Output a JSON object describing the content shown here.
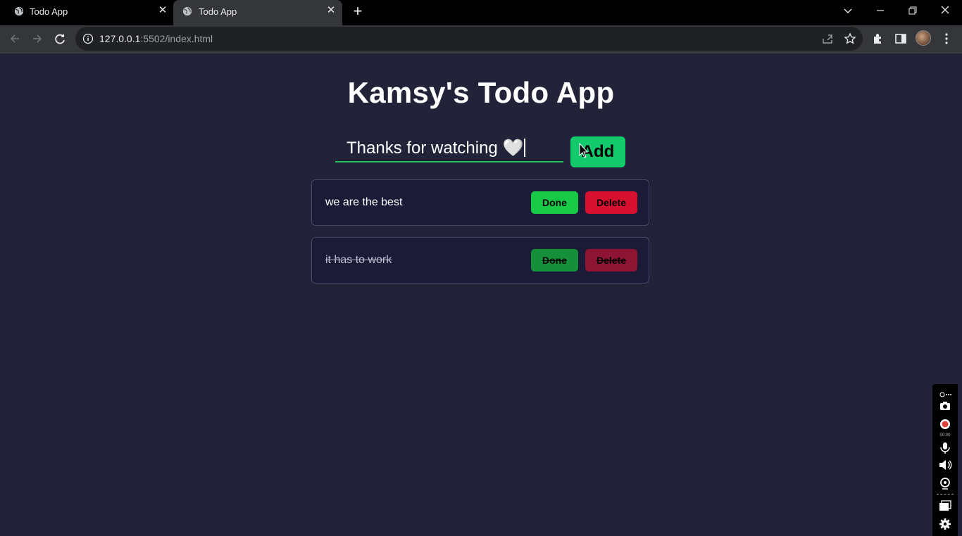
{
  "browser": {
    "tabs": [
      {
        "title": "Todo App"
      },
      {
        "title": "Todo App"
      }
    ],
    "address": {
      "host": "127.0.0.1",
      "path": ":5502/index.html"
    }
  },
  "app": {
    "title": "Kamsy's Todo App",
    "input_value": "Thanks for watching 🤍",
    "add_label": "Add",
    "todos": [
      {
        "text": "we are the best",
        "done_label": "Done",
        "delete_label": "Delete",
        "completed": false
      },
      {
        "text": "it has to work",
        "done_label": "Done",
        "delete_label": "Delete",
        "completed": true
      }
    ]
  },
  "recorder": {
    "timer": "00:00"
  },
  "colors": {
    "page_bg": "#222239",
    "card_bg": "#1b1a37",
    "add_button": "#12c96c",
    "done_button": "#17c944",
    "delete_button": "#d8102f",
    "input_underline": "#21c15a"
  }
}
